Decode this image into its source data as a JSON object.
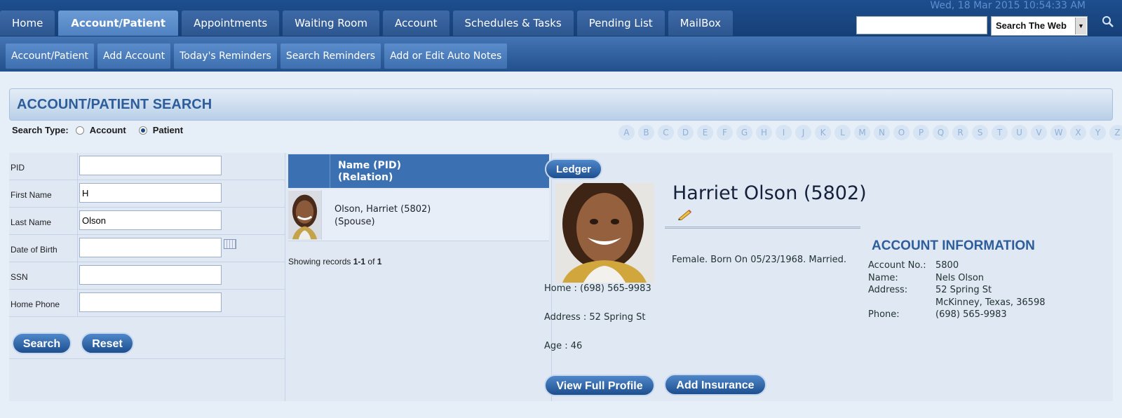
{
  "header": {
    "datetime": "Wed, 18 Mar 2015 10:54:33 AM",
    "tabs": [
      "Home",
      "Account/Patient",
      "Appointments",
      "Waiting Room",
      "Account",
      "Schedules & Tasks",
      "Pending List",
      "MailBox"
    ],
    "active_tab": "Account/Patient",
    "search_web_input": "",
    "search_web_select": "Search The Web"
  },
  "subnav": {
    "items": [
      "Account/Patient",
      "Add Account",
      "Today's Reminders",
      "Search Reminders",
      "Add or Edit Auto Notes"
    ]
  },
  "page": {
    "title": "ACCOUNT/PATIENT SEARCH",
    "search_type_label": "Search Type:",
    "search_type_options": [
      "Account",
      "Patient"
    ],
    "search_type_selected": "Patient",
    "alphabet": [
      "A",
      "B",
      "C",
      "D",
      "E",
      "F",
      "G",
      "H",
      "I",
      "J",
      "K",
      "L",
      "M",
      "N",
      "O",
      "P",
      "Q",
      "R",
      "S",
      "T",
      "U",
      "V",
      "W",
      "X",
      "Y",
      "Z"
    ]
  },
  "form": {
    "fields": [
      {
        "label": "PID",
        "value": ""
      },
      {
        "label": "First Name",
        "value": "H"
      },
      {
        "label": "Last Name",
        "value": "Olson"
      },
      {
        "label": "Date of Birth",
        "value": ""
      },
      {
        "label": "SSN",
        "value": ""
      },
      {
        "label": "Home Phone",
        "value": ""
      }
    ],
    "search_button": "Search",
    "reset_button": "Reset"
  },
  "results": {
    "header_line1": "Name (PID)",
    "header_line2": "(Relation)",
    "row_name": "Olson, Harriet (5802)",
    "row_relation": "(Spouse)",
    "records_prefix": "Showing records ",
    "records_range": "1-1",
    "records_of": " of ",
    "records_total": "1"
  },
  "detail": {
    "ledger_button": "Ledger",
    "name": "Harriet Olson (5802)",
    "summary": "Female. Born On 05/23/1968. Married.",
    "home_phone": "Home : (698) 565-9983",
    "address": "Address : 52 Spring St",
    "age": "Age : 46",
    "view_profile_button": "View Full Profile",
    "add_insurance_button": "Add Insurance"
  },
  "account_info": {
    "title": "ACCOUNT INFORMATION",
    "account_no_label": "Account No.:",
    "account_no": "5800",
    "name_label": "Name:",
    "name": "Nels Olson",
    "address_label": "Address:",
    "address_line1": "52 Spring St",
    "address_line2": "McKinney, Texas, 36598",
    "phone_label": "Phone:",
    "phone": "(698) 565-9983"
  }
}
